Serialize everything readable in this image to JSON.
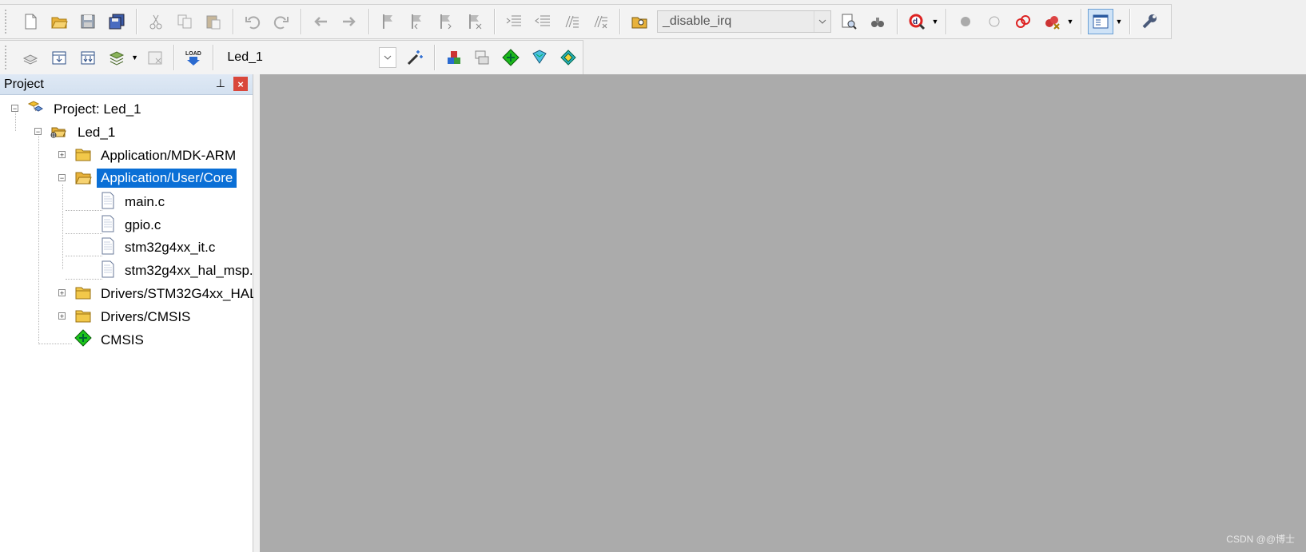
{
  "toolbar_build": {
    "find_combo_value": "_disable_irq"
  },
  "toolbar_target": {
    "target_combo_value": "Led_1"
  },
  "project_panel": {
    "title": "Project",
    "pin_glyph": "⊥",
    "close_glyph": "×"
  },
  "tree": {
    "root": "Project: Led_1",
    "target": "Led_1",
    "groups": [
      {
        "label": "Application/MDK-ARM",
        "expanded": false
      },
      {
        "label": "Application/User/Core",
        "expanded": true,
        "selected": true,
        "files": [
          "main.c",
          "gpio.c",
          "stm32g4xx_it.c",
          "stm32g4xx_hal_msp."
        ]
      },
      {
        "label": "Drivers/STM32G4xx_HAL",
        "expanded": false
      },
      {
        "label": "Drivers/CMSIS",
        "expanded": false
      },
      {
        "label": "CMSIS",
        "kind": "component"
      }
    ]
  },
  "watermark": "CSDN @@博士",
  "colors": {
    "selection": "#0a6fd6",
    "editor_bg": "#ababab",
    "panel_header": "#d4e1f0",
    "close_button": "#d9473b"
  }
}
